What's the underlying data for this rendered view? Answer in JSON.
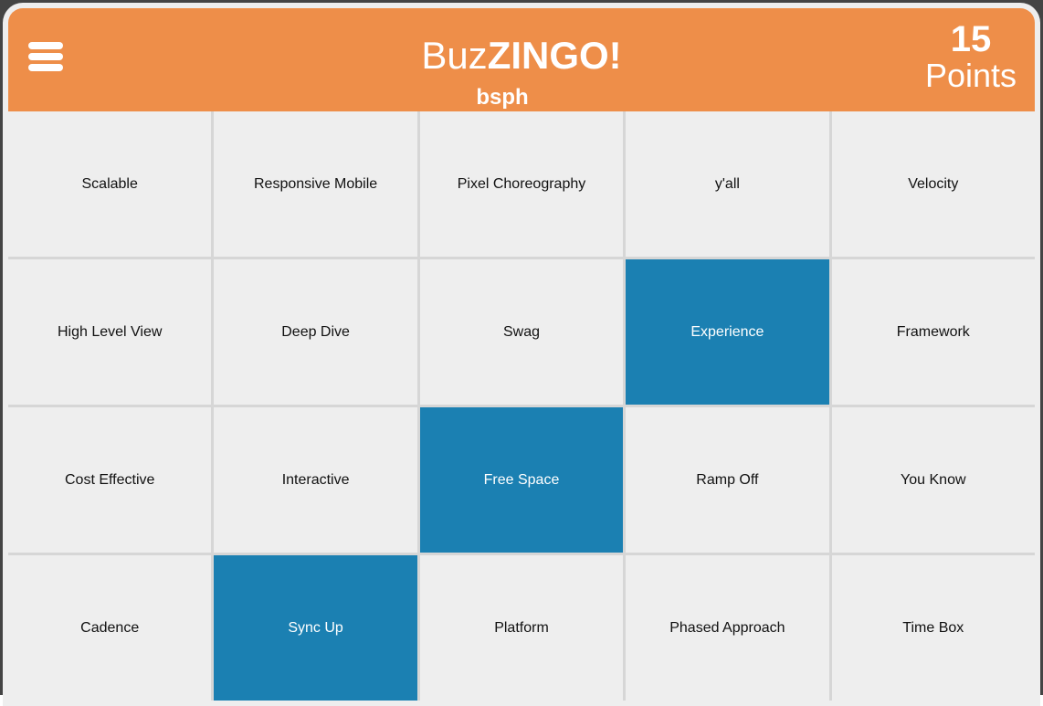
{
  "header": {
    "title_light": "Buz",
    "title_bold": "ZINGO!",
    "subtitle": "bsph",
    "points_value": "15",
    "points_label": "Points",
    "menu_icon": "hamburger-menu-icon",
    "color": "#ee8e49"
  },
  "board": {
    "marked_color": "#1b80b2",
    "cells": [
      {
        "label": "Scalable",
        "marked": false
      },
      {
        "label": "Responsive Mobile",
        "marked": false
      },
      {
        "label": "Pixel Choreography",
        "marked": false
      },
      {
        "label": "y'all",
        "marked": false
      },
      {
        "label": "Velocity",
        "marked": false
      },
      {
        "label": "High Level View",
        "marked": false
      },
      {
        "label": "Deep Dive",
        "marked": false
      },
      {
        "label": "Swag",
        "marked": false
      },
      {
        "label": "Experience",
        "marked": true
      },
      {
        "label": "Framework",
        "marked": false
      },
      {
        "label": "Cost Effective",
        "marked": false
      },
      {
        "label": "Interactive",
        "marked": false
      },
      {
        "label": "Free Space",
        "marked": true
      },
      {
        "label": "Ramp Off",
        "marked": false
      },
      {
        "label": "You Know",
        "marked": false
      },
      {
        "label": "Cadence",
        "marked": false
      },
      {
        "label": "Sync Up",
        "marked": true
      },
      {
        "label": "Platform",
        "marked": false
      },
      {
        "label": "Phased Approach",
        "marked": false
      },
      {
        "label": "Time Box",
        "marked": false
      }
    ]
  }
}
